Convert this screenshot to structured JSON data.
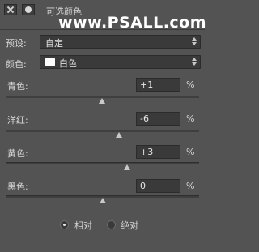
{
  "header": {
    "title": "可选颜色",
    "watermark": "www.PSALL.com"
  },
  "preset": {
    "label": "预设:",
    "value": "自定"
  },
  "colors": {
    "label": "颜色:",
    "value": "白色",
    "swatch_color": "#ffffff"
  },
  "sliders": [
    {
      "label": "青色:",
      "value": "+1",
      "unit": "%"
    },
    {
      "label": "洋红:",
      "value": "-6",
      "unit": "%"
    },
    {
      "label": "黄色:",
      "value": "+3",
      "unit": "%"
    },
    {
      "label": "黑色:",
      "value": "0",
      "unit": "%"
    }
  ],
  "method": {
    "relative_label": "相对",
    "absolute_label": "绝对",
    "selected": "relative"
  }
}
